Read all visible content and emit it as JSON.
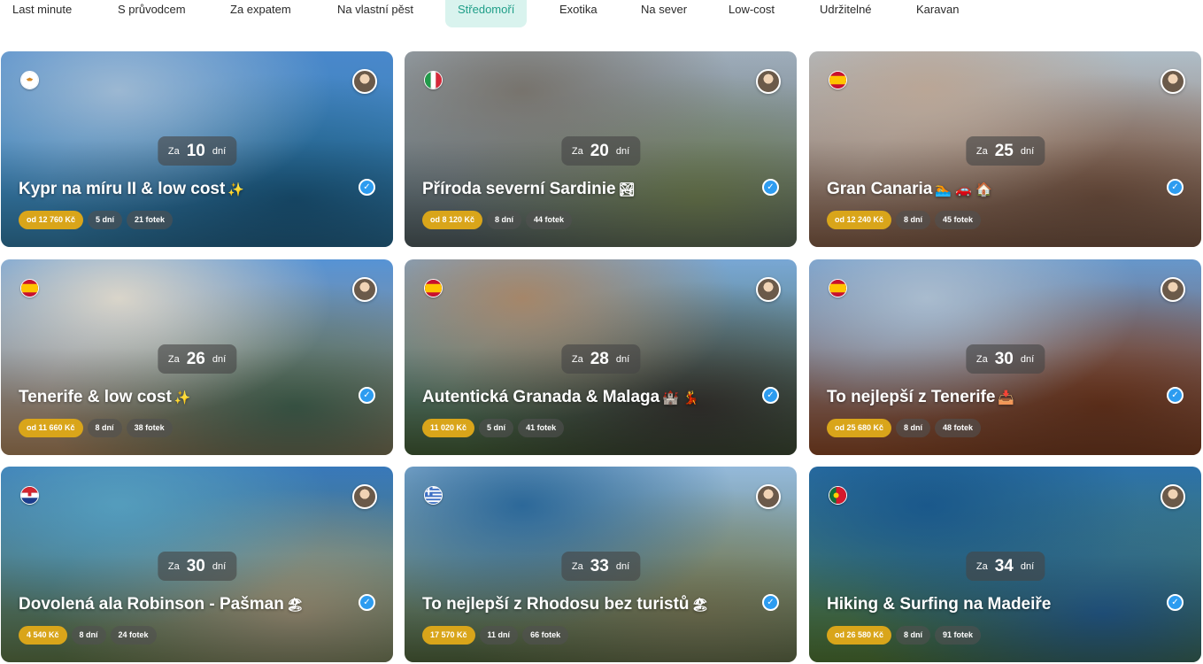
{
  "tabs": [
    {
      "label": "Last minute",
      "active": false
    },
    {
      "label": "S průvodcem",
      "active": false
    },
    {
      "label": "Za expatem",
      "active": false
    },
    {
      "label": "Na vlastní pěst",
      "active": false
    },
    {
      "label": "Středomoří",
      "active": true
    },
    {
      "label": "Exotika",
      "active": false
    },
    {
      "label": "Na sever",
      "active": false
    },
    {
      "label": "Low-cost",
      "active": false
    },
    {
      "label": "Udržitelné",
      "active": false
    },
    {
      "label": "Karavan",
      "active": false
    }
  ],
  "duration_prefix": "Za",
  "duration_suffix": "dní",
  "trips": [
    {
      "title": "Kypr na míru II & low cost",
      "emoji": "✨",
      "days": "10",
      "price": "od 12 760 Kč",
      "length": "5 dní",
      "photos": "21 fotek",
      "flag": "cyprus",
      "colors": [
        "#4d8fd6",
        "#a6c4e0",
        "#3a8fbf",
        "#1d5f88"
      ]
    },
    {
      "title": "Příroda severní Sardinie",
      "emoji": "🏞",
      "days": "20",
      "price": "od 8 120 Kč",
      "length": "8 dní",
      "photos": "44 fotek",
      "flag": "italy",
      "colors": [
        "#a7b6c4",
        "#7f7b74",
        "#5c6b6e",
        "#7a8a5a"
      ]
    },
    {
      "title": "Gran Canaria",
      "emoji": "🏊 🚗 🏠",
      "days": "25",
      "price": "od 12 240 Kč",
      "length": "8 dní",
      "photos": "45 fotek",
      "flag": "spain",
      "colors": [
        "#b8c7d2",
        "#c6b1a0",
        "#9a6d52",
        "#7d5a47"
      ]
    },
    {
      "title": "Tenerife & low cost",
      "emoji": "✨",
      "days": "26",
      "price": "od 11 660 Kč",
      "length": "8 dní",
      "photos": "38 fotek",
      "flag": "spain",
      "colors": [
        "#5b9be0",
        "#e8e3d7",
        "#c99a6a",
        "#4a6f5a"
      ]
    },
    {
      "title": "Autentická Granada & Malaga",
      "emoji": "🏰 💃",
      "days": "28",
      "price": "11 020 Kč",
      "length": "5 dní",
      "photos": "41 fotek",
      "flag": "spain",
      "colors": [
        "#7fb0e0",
        "#b08f70",
        "#4f6e3f",
        "#3d3a36"
      ]
    },
    {
      "title": "To nejlepší z Tenerife",
      "emoji": "📥",
      "days": "30",
      "price": "od 25 680 Kč",
      "length": "8 dní",
      "photos": "48 fotek",
      "flag": "spain",
      "colors": [
        "#6c9fd6",
        "#b4c8dc",
        "#a2542c",
        "#7a3d22"
      ]
    },
    {
      "title": "Dovolená ala Robinson - Pašman",
      "emoji": "🏖",
      "days": "30",
      "price": "4 540 Kč",
      "length": "8 dní",
      "photos": "24 fotek",
      "flag": "croatia",
      "colors": [
        "#3b7fc4",
        "#5aa7c9",
        "#6e8a52",
        "#b5a88a"
      ]
    },
    {
      "title": "To nejlepší z Rhodosu bez turistů",
      "emoji": "🏖",
      "days": "33",
      "price": "17 570 Kč",
      "length": "11 dní",
      "photos": "66 fotek",
      "flag": "greece",
      "colors": [
        "#9cc3e6",
        "#2f6fa3",
        "#5f7747",
        "#8a8a64"
      ]
    },
    {
      "title": "Hiking & Surfing na Madeiře",
      "emoji": "",
      "days": "34",
      "price": "od 26 580 Kč",
      "length": "8 dní",
      "photos": "91 fotek",
      "flag": "portugal",
      "colors": [
        "#2e78b4",
        "#1c5e94",
        "#5e8a3c",
        "#2a6aa3"
      ]
    }
  ]
}
